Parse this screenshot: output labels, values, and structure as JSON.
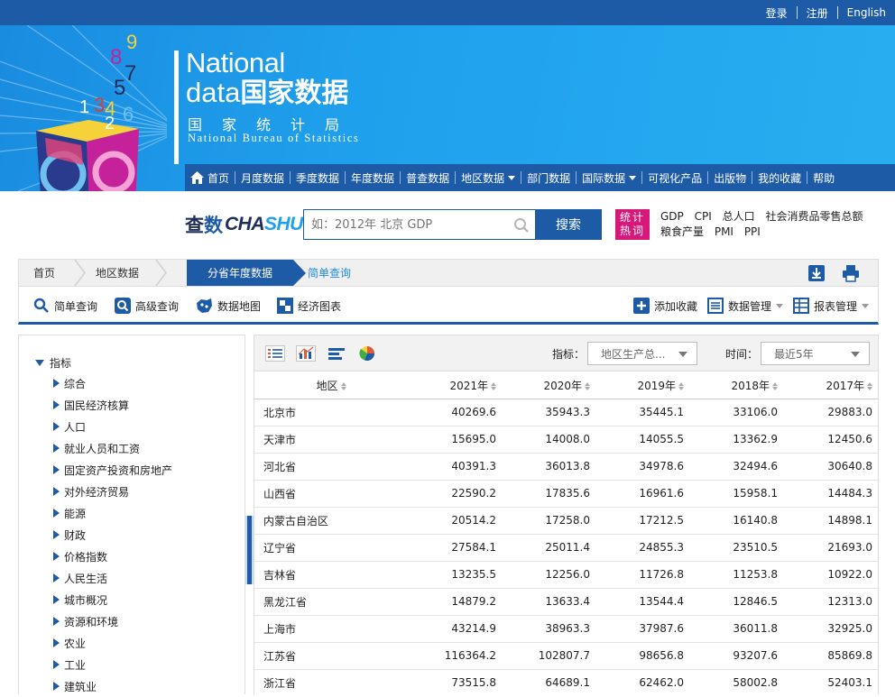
{
  "topbar": {
    "login": "登录",
    "register": "注册",
    "english": "English"
  },
  "brand": {
    "en_line1": "National",
    "en_line2": "data",
    "cn_title": "国家数据",
    "bureau_cn": "国家统计局",
    "bureau_en": "National Bureau of Statistics",
    "cube_digits": [
      "1",
      "2",
      "3",
      "4",
      "5",
      "6",
      "7",
      "8",
      "9"
    ]
  },
  "mainnav": {
    "home": "首页",
    "items": [
      {
        "label": "月度数据",
        "dropdown": false
      },
      {
        "label": "季度数据",
        "dropdown": false
      },
      {
        "label": "年度数据",
        "dropdown": false
      },
      {
        "label": "普查数据",
        "dropdown": false
      },
      {
        "label": "地区数据",
        "dropdown": true
      },
      {
        "label": "部门数据",
        "dropdown": false
      },
      {
        "label": "国际数据",
        "dropdown": true
      },
      {
        "label": "可视化产品",
        "dropdown": false
      },
      {
        "label": "出版物",
        "dropdown": false
      },
      {
        "label": "我的收藏",
        "dropdown": false
      },
      {
        "label": "帮助",
        "dropdown": false
      }
    ]
  },
  "search": {
    "logo_cn1": "查",
    "logo_cn2": "数",
    "logo_en": "CHA",
    "logo_en2": "SHU",
    "placeholder": "如：2012年 北京 GDP",
    "button": "搜索",
    "hot_badge_line1": "统计",
    "hot_badge_line2": "热词",
    "hot_words": [
      "GDP",
      "CPI",
      "总人口",
      "社会消费品零售总额",
      "粮食产量",
      "PMI",
      "PPI"
    ]
  },
  "breadcrumb": {
    "home": "首页",
    "region": "地区数据",
    "active": "分省年度数据",
    "current": "简单查询"
  },
  "tools": {
    "simple_query": "简单查询",
    "advanced_query": "高级查询",
    "data_map": "数据地图",
    "econ_chart": "经济图表",
    "add_fav": "添加收藏",
    "data_mgmt": "数据管理",
    "report_mgmt": "报表管理"
  },
  "sidebar": {
    "root": "指标",
    "items": [
      "综合",
      "国民经济核算",
      "人口",
      "就业人员和工资",
      "固定资产投资和房地产",
      "对外经济贸易",
      "能源",
      "财政",
      "价格指数",
      "人民生活",
      "城市概况",
      "资源和环境",
      "农业",
      "工业",
      "建筑业"
    ]
  },
  "panel": {
    "indicator_label": "指标：",
    "indicator_value": "地区生产总...",
    "time_label": "时间：",
    "time_value": "最近5年"
  },
  "table": {
    "columns": [
      "地区",
      "2021年",
      "2020年",
      "2019年",
      "2018年",
      "2017年"
    ],
    "rows": [
      [
        "北京市",
        "40269.6",
        "35943.3",
        "35445.1",
        "33106.0",
        "29883.0"
      ],
      [
        "天津市",
        "15695.0",
        "14008.0",
        "14055.5",
        "13362.9",
        "12450.6"
      ],
      [
        "河北省",
        "40391.3",
        "36013.8",
        "34978.6",
        "32494.6",
        "30640.8"
      ],
      [
        "山西省",
        "22590.2",
        "17835.6",
        "16961.6",
        "15958.1",
        "14484.3"
      ],
      [
        "内蒙古自治区",
        "20514.2",
        "17258.0",
        "17212.5",
        "16140.8",
        "14898.1"
      ],
      [
        "辽宁省",
        "27584.1",
        "25011.4",
        "24855.3",
        "23510.5",
        "21693.0"
      ],
      [
        "吉林省",
        "13235.5",
        "12256.0",
        "11726.8",
        "11253.8",
        "10922.0"
      ],
      [
        "黑龙江省",
        "14879.2",
        "13633.4",
        "13544.4",
        "12846.5",
        "12313.0"
      ],
      [
        "上海市",
        "43214.9",
        "38963.3",
        "37987.6",
        "36011.8",
        "32925.0"
      ],
      [
        "江苏省",
        "116364.2",
        "102807.7",
        "98656.8",
        "93207.6",
        "85869.8"
      ],
      [
        "浙江省",
        "73515.8",
        "64689.1",
        "62462.0",
        "58002.8",
        "52403.1"
      ]
    ]
  },
  "colors": {
    "nav_blue": "#1e5ba7",
    "banner_blue": "#1fa0ec",
    "hot_pink": "#d6187a",
    "link_blue": "#1e8ad6"
  }
}
